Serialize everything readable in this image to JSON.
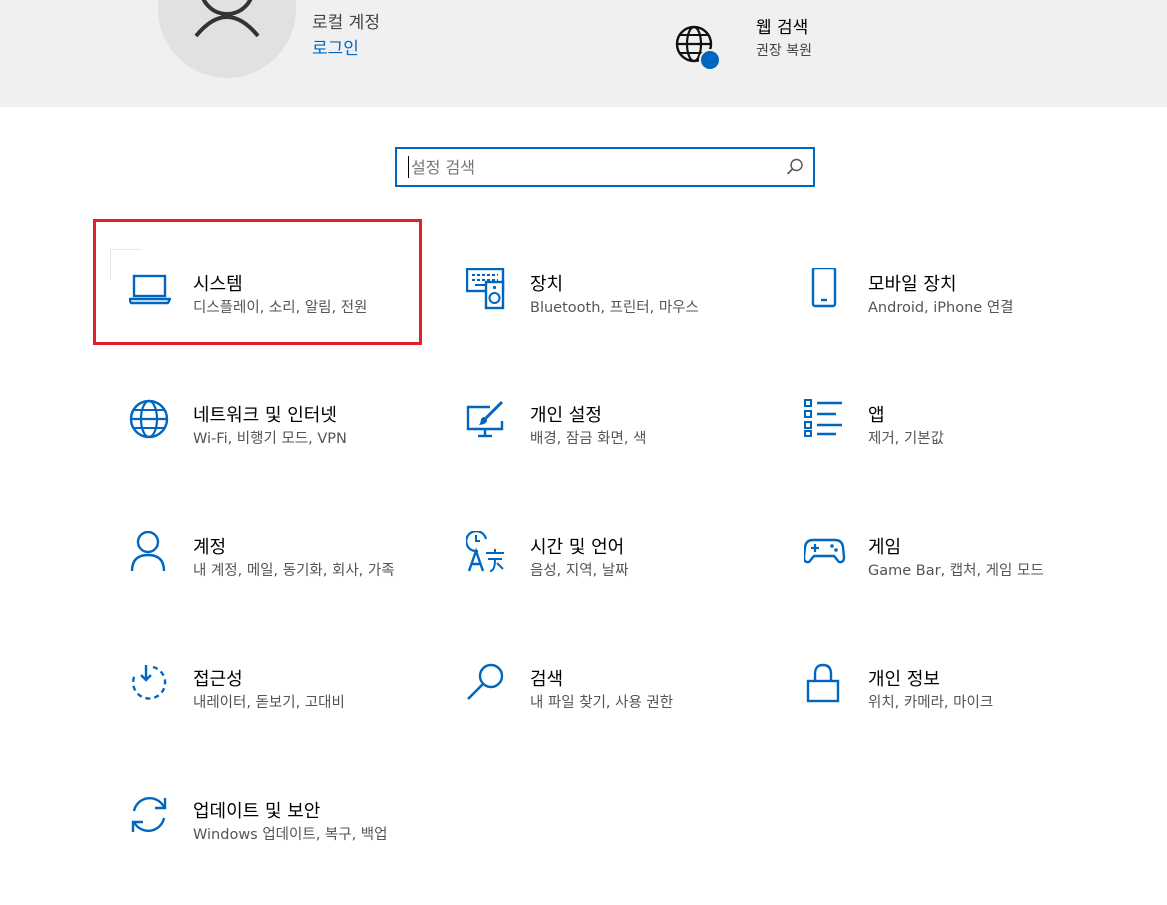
{
  "header": {
    "account_kind": "로컬 계정",
    "login_link": "로그인",
    "web_search": {
      "title": "웹 검색",
      "subtitle": "권장 복원"
    }
  },
  "search": {
    "placeholder": "설정 검색",
    "value": ""
  },
  "highlight_color": "#e0202a",
  "accent_color": "#0067c0",
  "tiles": [
    {
      "icon": "laptop-icon",
      "title": "시스템",
      "subtitle": "디스플레이, 소리, 알림, 전원"
    },
    {
      "icon": "keyboard-speaker-icon",
      "title": "장치",
      "subtitle": "Bluetooth, 프린터, 마우스"
    },
    {
      "icon": "phone-icon",
      "title": "모바일 장치",
      "subtitle": "Android, iPhone 연결"
    },
    {
      "icon": "globe-icon",
      "title": "네트워크 및 인터넷",
      "subtitle": "Wi-Fi, 비행기 모드, VPN"
    },
    {
      "icon": "paintbrush-icon",
      "title": "개인 설정",
      "subtitle": "배경, 잠금 화면, 색"
    },
    {
      "icon": "apps-list-icon",
      "title": "앱",
      "subtitle": "제거, 기본값"
    },
    {
      "icon": "person-icon",
      "title": "계정",
      "subtitle": "내 계정, 메일, 동기화, 회사, 가족"
    },
    {
      "icon": "time-language-icon",
      "title": "시간 및 언어",
      "subtitle": "음성, 지역, 날짜"
    },
    {
      "icon": "gamepad-icon",
      "title": "게임",
      "subtitle": "Game Bar, 캡처, 게임 모드"
    },
    {
      "icon": "accessibility-timer-icon",
      "title": "접근성",
      "subtitle": "내레이터, 돋보기, 고대비"
    },
    {
      "icon": "magnifier-icon",
      "title": "검색",
      "subtitle": "내 파일 찾기, 사용 권한"
    },
    {
      "icon": "lock-icon",
      "title": "개인 정보",
      "subtitle": "위치, 카메라, 마이크"
    },
    {
      "icon": "sync-icon",
      "title": "업데이트 및 보안",
      "subtitle": "Windows 업데이트, 복구, 백업"
    }
  ]
}
